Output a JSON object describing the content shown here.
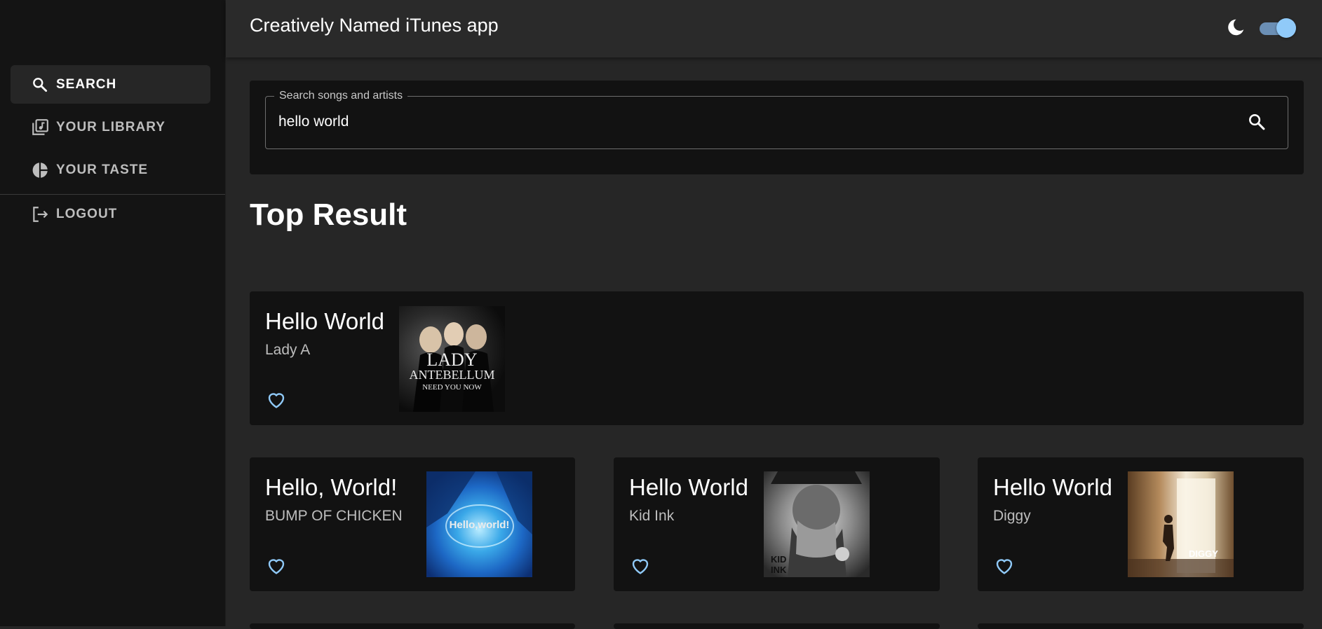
{
  "app": {
    "title": "Creatively Named iTunes app",
    "theme_icon": "moon-icon",
    "dark_mode_enabled": true
  },
  "sidebar": {
    "items": [
      {
        "label": "SEARCH",
        "icon": "search-icon",
        "active": true
      },
      {
        "label": "YOUR LIBRARY",
        "icon": "library-music-icon",
        "active": false
      },
      {
        "label": "YOUR TASTE",
        "icon": "pie-chart-icon",
        "active": false
      }
    ],
    "logout": {
      "label": "LOGOUT",
      "icon": "logout-icon"
    }
  },
  "search": {
    "label": "Search songs and artists",
    "value": "hello world",
    "button_icon": "search-icon"
  },
  "top_result": {
    "heading": "Top Result",
    "title": "Hello World",
    "artist": "Lady A",
    "artwork": {
      "line1": "LADY",
      "line2": "ANTEBELLUM",
      "line3": "NEED YOU NOW"
    },
    "favorite_icon": "heart-outline-icon"
  },
  "results": [
    {
      "title": "Hello, World!",
      "artist": "BUMP OF CHICKEN",
      "artwork_text": "Hello,world!",
      "favorite_icon": "heart-outline-icon"
    },
    {
      "title": "Hello World",
      "artist": "Kid Ink",
      "artwork_text": "KID INK",
      "favorite_icon": "heart-outline-icon"
    },
    {
      "title": "Hello World",
      "artist": "Diggy",
      "artwork_text": "DIGGY",
      "favorite_icon": "heart-outline-icon"
    }
  ],
  "colors": {
    "accent": "#90caf9",
    "background": "#262626",
    "card": "#121212",
    "sidebar": "#141414"
  }
}
